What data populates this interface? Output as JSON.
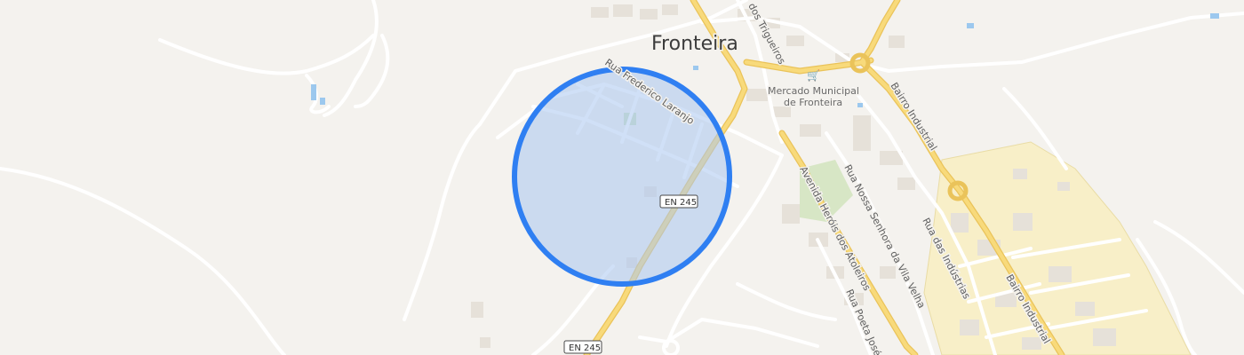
{
  "map": {
    "city_label": "Fronteira",
    "poi": {
      "line1": "Mercado Municipal",
      "line2": "de Fronteira",
      "icon": "shopping-cart-icon"
    },
    "streets": {
      "frederico": "Rua Frederico Laranjo",
      "trigueiros": "dos Trigueiros",
      "bairro_industrial": "Bairro Industrial",
      "avenida": "Avenida Heróis dos Atoleiros",
      "senhora": "Rua Nossa Senhora da Vila Velha",
      "industrias": "Rua das Indústrias",
      "poeta": "Rua Poeta José"
    },
    "route_shields": {
      "main": "EN 245",
      "bottom": "EN 245"
    },
    "colors": {
      "background": "#f4f2ee",
      "highway": "#f5d36a",
      "radius_fill": "#a9c6f0",
      "radius_stroke": "#2f7ff2",
      "industrial": "#f8efc8"
    }
  }
}
